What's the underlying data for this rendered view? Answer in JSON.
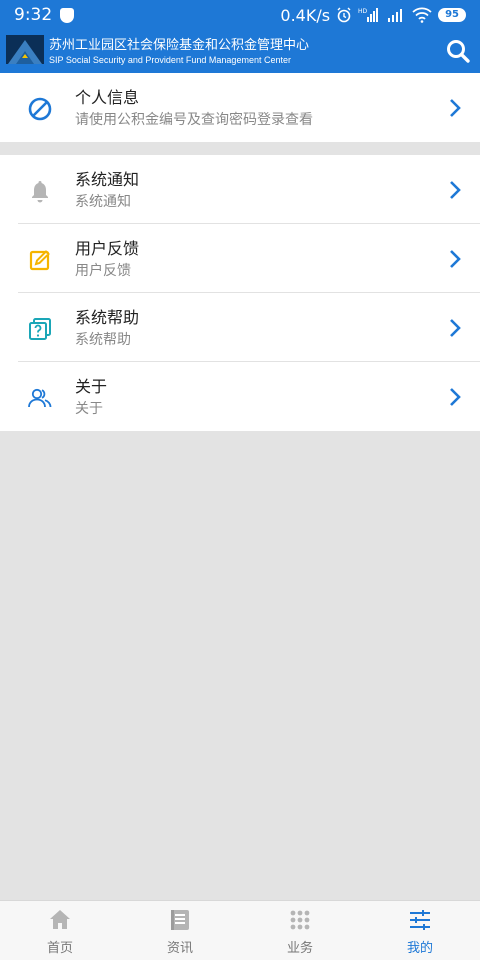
{
  "status_bar": {
    "time": "9:32",
    "network_speed": "0.4K/s",
    "battery": "95"
  },
  "header": {
    "title_cn": "苏州工业园区社会保险基金和公积金管理中心",
    "title_en": "SIP Social Security and Provident Fund Management Center"
  },
  "menu": {
    "personal": {
      "title": "个人信息",
      "subtitle": "请使用公积金编号及查询密码登录查看"
    },
    "notice": {
      "title": "系统通知",
      "subtitle": "系统通知"
    },
    "feedback": {
      "title": "用户反馈",
      "subtitle": "用户反馈"
    },
    "help": {
      "title": "系统帮助",
      "subtitle": "系统帮助"
    },
    "about": {
      "title": "关于",
      "subtitle": "关于"
    }
  },
  "tabs": [
    {
      "label": "首页"
    },
    {
      "label": "资讯"
    },
    {
      "label": "业务"
    },
    {
      "label": "我的"
    }
  ],
  "colors": {
    "brand_blue": "#1e78d6",
    "feedback_yellow": "#f5b400",
    "help_teal": "#1aa6b7",
    "notice_gray": "#b5b5b5"
  }
}
